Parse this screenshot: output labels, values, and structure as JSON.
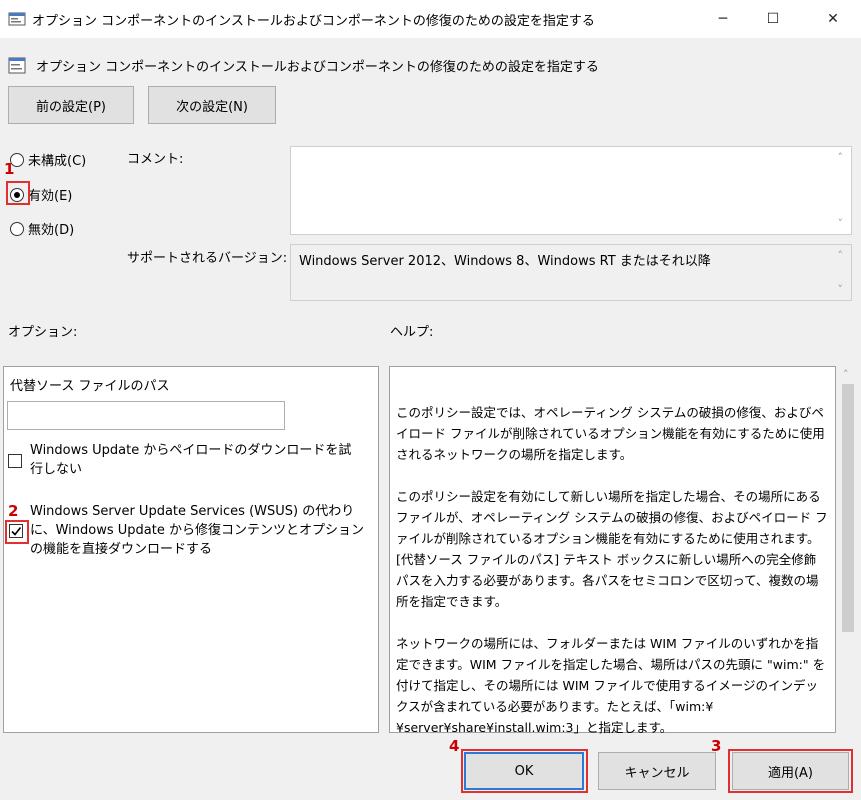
{
  "window": {
    "title": "オプション コンポーネントのインストールおよびコンポーネントの修復のための設定を指定する",
    "minimize_glyph": "─",
    "maximize_glyph": "☐",
    "close_glyph": "✕"
  },
  "header": {
    "title": "オプション コンポーネントのインストールおよびコンポーネントの修復のための設定を指定する",
    "prev_label": "前の設定(P)",
    "next_label": "次の設定(N)"
  },
  "state": {
    "options": [
      {
        "label": "未構成(C)",
        "selected": false
      },
      {
        "label": "有効(E)",
        "selected": true
      },
      {
        "label": "無効(D)",
        "selected": false
      }
    ]
  },
  "comment": {
    "label": "コメント:",
    "value": ""
  },
  "support": {
    "label": "サポートされるバージョン:",
    "value": "Windows Server 2012、Windows 8、Windows RT またはそれ以降"
  },
  "options_section": {
    "label": "オプション:",
    "alt_source_label": "代替ソース ファイルのパス",
    "alt_source_value": "",
    "checkbox1_label": "Windows Update からペイロードのダウンロードを試行しない",
    "checkbox1_checked": false,
    "checkbox2_label": "Windows Server Update Services (WSUS) の代わりに、Windows Update から修復コンテンツとオプションの機能を直接ダウンロードする",
    "checkbox2_checked": true
  },
  "help_section": {
    "label": "ヘルプ:",
    "paragraphs": [
      "このポリシー設定では、オペレーティング システムの破損の修復、およびペイロード ファイルが削除されているオプション機能を有効にするために使用されるネットワークの場所を指定します。",
      "このポリシー設定を有効にして新しい場所を指定した場合、その場所にあるファイルが、オペレーティング システムの破損の修復、およびペイロード ファイルが削除されているオプション機能を有効にするために使用されます。[代替ソース ファイルのパス] テキスト ボックスに新しい場所への完全修飾パスを入力する必要があります。各パスをセミコロンで区切って、複数の場所を指定できます。",
      "ネットワークの場所には、フォルダーまたは WIM ファイルのいずれかを指定できます。WIM ファイルを指定した場合、場所はパスの先頭に \"wim:\" を付けて指定し、その場所には WIM ファイルで使用するイメージのインデックスが含まれている必要があります。たとえば、「wim:¥¥server¥share¥install.wim:3」と指定します。"
    ]
  },
  "footer": {
    "ok_label": "OK",
    "cancel_label": "キャンセル",
    "apply_label": "適用(A)"
  },
  "annotations": {
    "step1": "1",
    "step2": "2",
    "step3": "3",
    "step4": "4"
  },
  "colors": {
    "annotation_red": "#e0302f",
    "focus_blue": "#2a7ad6"
  }
}
